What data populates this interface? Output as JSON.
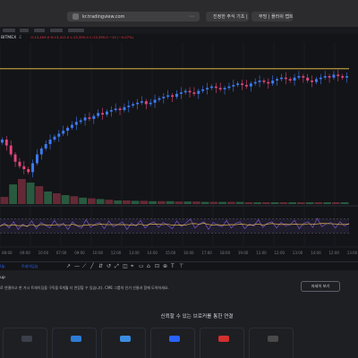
{
  "browser": {
    "url": "kr.tradingview.com",
    "tabs": [
      {
        "label": "진정한 주식 기초 |",
        "favicon_color": "#2962ff"
      },
      {
        "label": "무빙 | 플러쉬 랩트",
        "favicon_color": "#ffffff"
      }
    ]
  },
  "symbol": {
    "name": "BITMEX",
    "ohlc_text": "O:13,409.0 H:13,412.0 L:13,395.0 C:13,399.0 −10 (−0.07%)"
  },
  "chart_data": {
    "type": "candlestick",
    "main": {
      "ylim": [
        0,
        100
      ],
      "horizontal_line": {
        "value": 88,
        "color": "#f7c948"
      },
      "close_series_description": "uptrend with dip near start",
      "closes": [
        40,
        36,
        30,
        25,
        22,
        20,
        18,
        24,
        30,
        34,
        37,
        40,
        42,
        44,
        46,
        48,
        50,
        52,
        53,
        55,
        54,
        56,
        58,
        57,
        59,
        60,
        61,
        60,
        62,
        63,
        64,
        65,
        66,
        64,
        65,
        67,
        68,
        69,
        70,
        69,
        71,
        72,
        73,
        72,
        71,
        73,
        74,
        75,
        76,
        75,
        74,
        75,
        76,
        77,
        78,
        77,
        76,
        78,
        79,
        80,
        79,
        78,
        80,
        81,
        82,
        81,
        80,
        82,
        83,
        82,
        80,
        79,
        81,
        82,
        83,
        82,
        84,
        83,
        82,
        83
      ]
    },
    "volume": {
      "values": [
        20,
        55,
        70,
        60,
        50,
        35,
        30,
        25,
        22,
        18,
        16,
        14,
        12,
        10,
        10,
        9,
        9,
        8,
        8,
        8,
        7,
        7,
        7,
        6,
        6,
        6,
        6,
        6,
        5,
        5,
        5,
        5,
        5,
        5,
        5,
        5,
        5,
        5,
        5,
        5
      ]
    },
    "oscillator": {
      "ylim": [
        0,
        100
      ],
      "upper_band": 70,
      "lower_band": 30,
      "values": [
        50,
        58,
        44,
        62,
        40,
        55,
        48,
        65,
        42,
        60,
        52,
        45,
        66,
        48,
        58,
        40,
        62,
        50,
        44,
        68,
        46,
        56,
        60,
        42,
        64,
        48,
        54,
        62,
        40,
        58,
        50,
        66,
        44,
        56,
        62,
        46,
        60,
        52,
        42,
        64,
        48,
        58,
        70,
        44,
        56,
        62,
        40,
        60,
        52,
        48,
        66,
        44,
        58,
        62,
        42,
        56,
        50,
        68,
        46,
        58,
        62,
        44,
        60,
        50,
        54,
        66,
        42,
        58,
        62,
        46,
        72,
        48,
        56,
        60,
        44,
        62,
        50,
        58
      ]
    },
    "time_labels": [
      "08:00",
      "09:00",
      "10:00",
      "07:00",
      "09:00",
      "10:00",
      "12:00",
      "13:00",
      "14:00",
      "15:00",
      "16:00",
      "17:00",
      "18:00",
      "19:00",
      "11:00",
      "12:00",
      "13:00",
      "14:00",
      "12:00",
      "13:00"
    ]
  },
  "drawing_bar": {
    "caption": "Up",
    "caption2": "트레이딩뷰",
    "tools": [
      "↗",
      "—",
      "⟋",
      "╱",
      "⇵",
      "↺",
      "⤢",
      "◫",
      "⌖",
      "▭",
      "⌂",
      "⊡",
      "⊕",
      "T",
      "⊤"
    ]
  },
  "panel": {
    "title": "up",
    "description": "로 연결하고 한 가시 트레이딩을 구독을 6개월 더 연장할 수 있습니다. CME 그룹의 인기 선물과 함께 도약하세요.",
    "more_button": "자세히 보기",
    "brokers_heading": "신뢰할 수 있는 브로커를 통한 연결",
    "broker_logo_colors": [
      "#3b3f4a",
      "#2e7bd6",
      "#3b8de0",
      "#2962ff",
      "#d32f2f",
      "#4a4a4a"
    ]
  }
}
